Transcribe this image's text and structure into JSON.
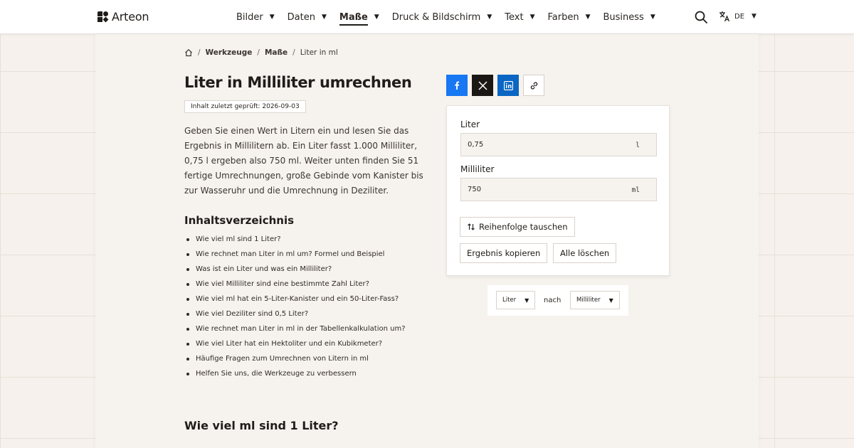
{
  "header": {
    "brand": "Arteon",
    "nav": [
      {
        "label": "Bilder",
        "active": false
      },
      {
        "label": "Daten",
        "active": false
      },
      {
        "label": "Maße",
        "active": true
      },
      {
        "label": "Druck & Bildschirm",
        "active": false
      },
      {
        "label": "Text",
        "active": false
      },
      {
        "label": "Farben",
        "active": false
      },
      {
        "label": "Business",
        "active": false
      }
    ],
    "caret": "▼",
    "language": "DE"
  },
  "breadcrumb": {
    "items": [
      "Werkzeuge",
      "Maße",
      "Liter in ml"
    ],
    "separator": "/"
  },
  "main": {
    "title": "Liter in Milliliter umrechnen",
    "review_badge": "Inhalt zuletzt geprüft: 2026-09-03",
    "intro": "Geben Sie einen Wert in Litern ein und lesen Sie das Ergebnis in Millilitern ab. Ein Liter fasst 1.000 Milliliter, 0,75 l ergeben also 750 ml. Weiter unten finden Sie 51 fertige Umrechnungen, große Gebinde vom Kanister bis zur Wasseruhr und die Umrechnung in Deziliter.",
    "toc_title": "Inhaltsverzeichnis",
    "toc": [
      "Wie viel ml sind 1 Liter?",
      "Wie rechnet man Liter in ml um? Formel und Beispiel",
      "Was ist ein Liter und was ein Milliliter?",
      "Wie viel Milliliter sind eine bestimmte Zahl Liter?",
      "Wie viel ml hat ein 5-Liter-Kanister und ein 50-Liter-Fass?",
      "Wie viel Deziliter sind 0,5 Liter?",
      "Wie rechnet man Liter in ml in der Tabellenkalkulation um?",
      "Wie viel Liter hat ein Hektoliter und ein Kubikmeter?",
      "Häufige Fragen zum Umrechnen von Litern in ml",
      "Helfen Sie uns, die Werkzeuge zu verbessern"
    ],
    "section_title": "Wie viel ml sind 1 Liter?"
  },
  "converter": {
    "from_label": "Liter",
    "from_value": "0,75",
    "from_unit": "l",
    "to_label": "Milliliter",
    "to_value": "750",
    "to_unit": "ml",
    "swap_label": "Reihenfolge tauschen",
    "copy_label": "Ergebnis kopieren",
    "clear_label": "Alle löschen"
  },
  "unit_select": {
    "from": "Liter",
    "connector": "nach",
    "to": "Milliliter"
  },
  "colors": {
    "facebook": "#1877f2",
    "x": "#1a1714",
    "linkedin": "#0a66c2"
  }
}
